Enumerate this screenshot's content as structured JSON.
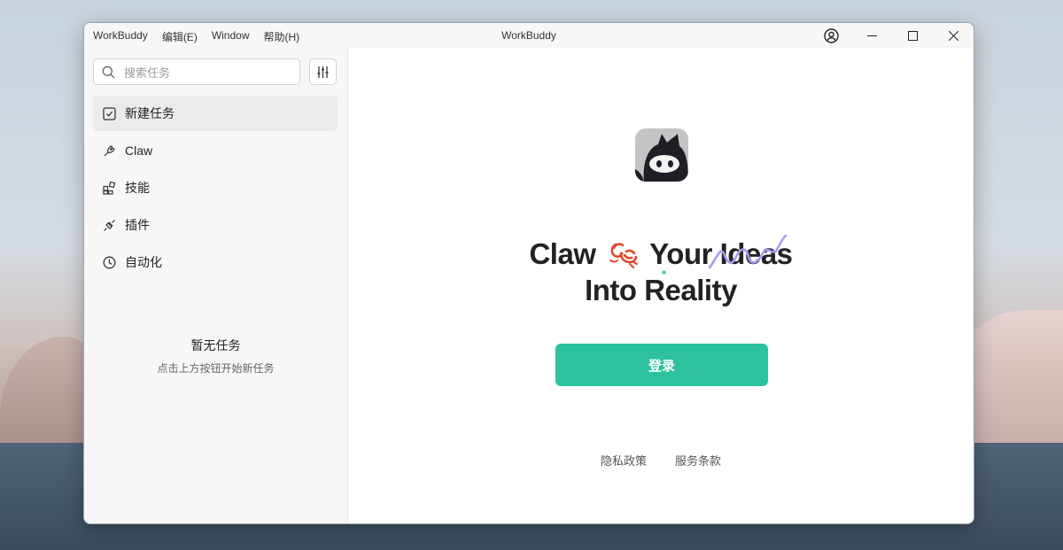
{
  "window": {
    "title": "WorkBuddy",
    "menu": [
      "WorkBuddy",
      "编辑(E)",
      "Window",
      "帮助(H)"
    ]
  },
  "sidebar": {
    "search_placeholder": "搜索任务",
    "items": [
      {
        "label": "新建任务",
        "icon": "new-task-icon",
        "active": true
      },
      {
        "label": "Claw",
        "icon": "claw-icon",
        "active": false
      },
      {
        "label": "技能",
        "icon": "skills-icon",
        "active": false
      },
      {
        "label": "插件",
        "icon": "plugin-icon",
        "active": false
      },
      {
        "label": "自动化",
        "icon": "clock-icon",
        "active": false
      }
    ],
    "empty_title": "暂无任务",
    "empty_subtitle": "点击上方按钮开始新任务"
  },
  "main": {
    "headline_line1_a": "Claw",
    "headline_line1_b": "Your Ideas",
    "headline_line2": "Into Reality",
    "login_label": "登录",
    "footer_links": [
      "隐私政策",
      "服务条款"
    ]
  },
  "colors": {
    "accent": "#2bc29d",
    "sidebar_bg": "#f7f7f7",
    "active_item_bg": "#ebebeb",
    "squiggle": "#a99cf0",
    "lobster": "#e04a2f"
  }
}
